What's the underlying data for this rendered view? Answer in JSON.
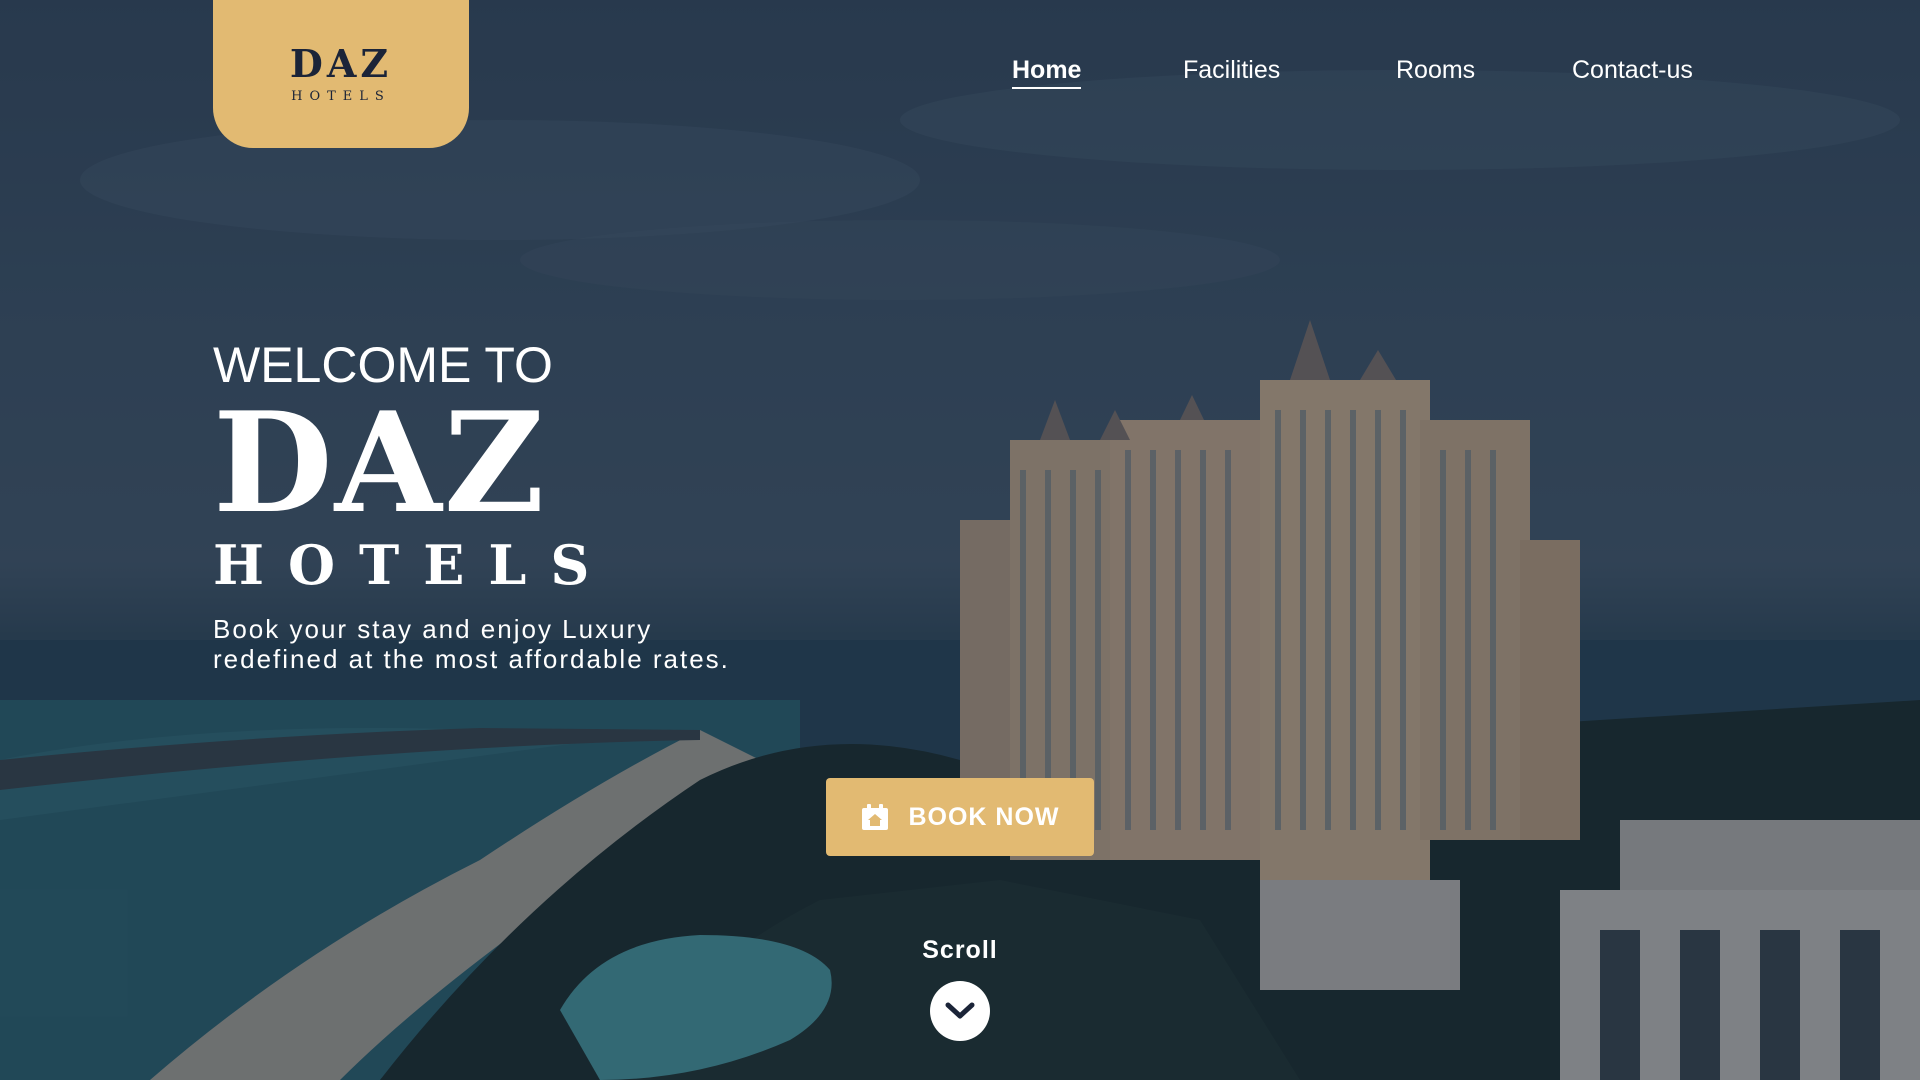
{
  "logo": {
    "main": "DAZ",
    "sub": "HOTELS"
  },
  "nav": {
    "items": [
      {
        "label": "Home",
        "active": true
      },
      {
        "label": "Facilities",
        "active": false
      },
      {
        "label": "Rooms",
        "active": false
      },
      {
        "label": "Contact-us",
        "active": false
      }
    ]
  },
  "hero": {
    "welcome": "WELCOME TO",
    "brand": "DAZ",
    "brand_sub": "HOTELS",
    "tagline_line1": "Book your stay and enjoy Luxury",
    "tagline_line2": "redefined at the most affordable rates."
  },
  "cta": {
    "label": "BOOK NOW",
    "icon": "calendar-icon"
  },
  "scroll": {
    "label": "Scroll",
    "icon": "chevron-down-icon"
  },
  "colors": {
    "accent": "#e2ba72",
    "text": "#ffffff",
    "logo_text": "#1b2438"
  }
}
